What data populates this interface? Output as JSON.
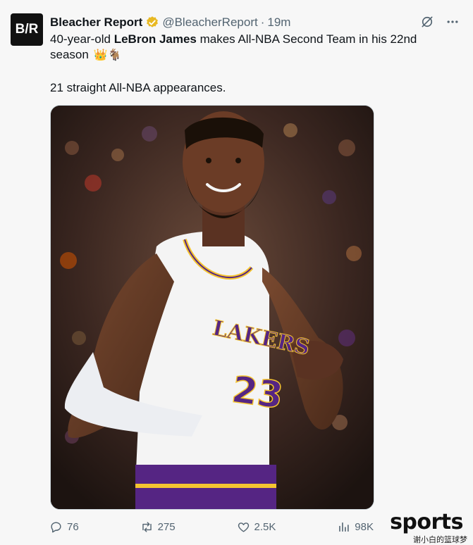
{
  "account": {
    "avatar_text": "B/R",
    "name": "Bleacher Report",
    "handle": "@BleacherReport",
    "separator": "·",
    "time": "19m"
  },
  "tweet": {
    "line1_prefix": "40-year-old ",
    "line1_bold": "LeBron James",
    "line1_suffix": " makes All-NBA Second Team in his 22nd season",
    "line1_emoji": "👑🐐",
    "line2": "21 straight All-NBA appearances."
  },
  "media": {
    "jersey_team": "LAKERS",
    "jersey_number": "23"
  },
  "actions": {
    "replies": "76",
    "retweets": "275",
    "likes": "2.5K",
    "views": "98K"
  },
  "watermark": {
    "brand": "sports",
    "sub": "谢小白的篮球梦"
  },
  "colors": {
    "accent_gold": "#f4c430",
    "verified_badge": "#e8b923",
    "laker_purple": "#552583",
    "text_secondary": "#536471"
  },
  "icons": [
    "verified-badge-icon",
    "grok-icon",
    "more-icon",
    "reply-icon",
    "retweet-icon",
    "like-icon",
    "views-icon"
  ]
}
